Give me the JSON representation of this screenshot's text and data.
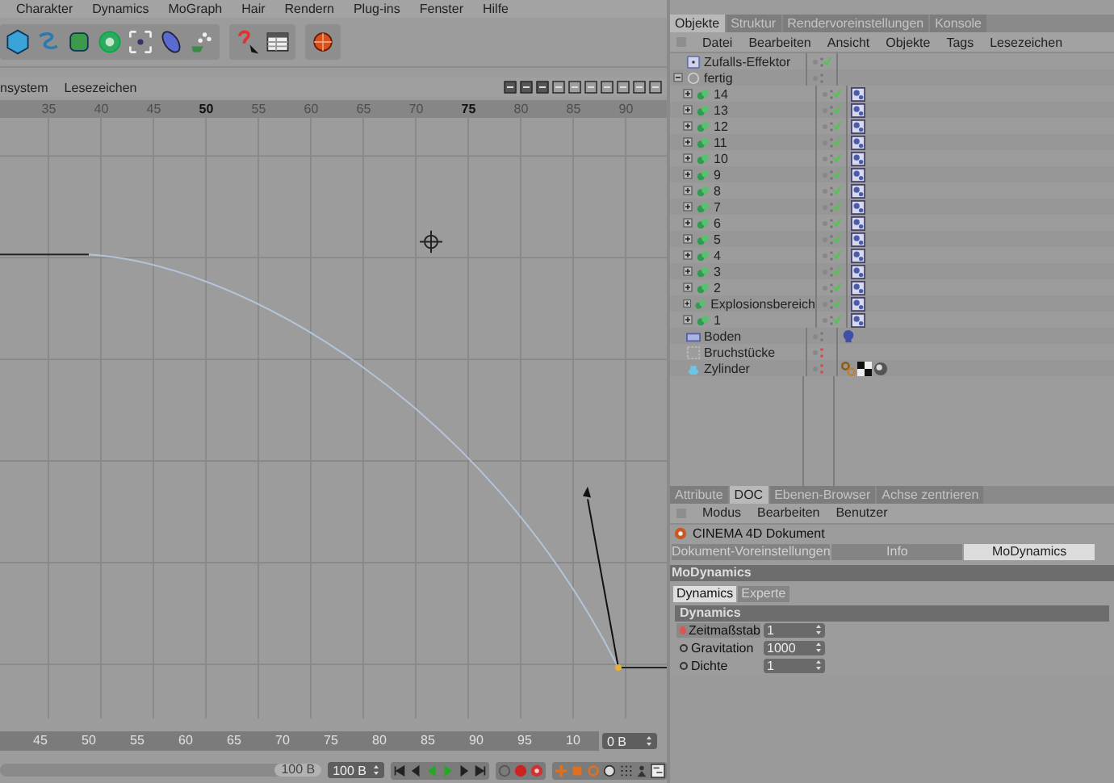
{
  "menu_bar": [
    "Charakter",
    "Dynamics",
    "MoGraph",
    "Hair",
    "Rendern",
    "Plug-ins",
    "Fenster",
    "Hilfe"
  ],
  "timeline_editor": {
    "menu": [
      "nsystem",
      "Lesezeichen"
    ],
    "ruler": [
      {
        "label": "35",
        "major": false
      },
      {
        "label": "40",
        "major": false
      },
      {
        "label": "45",
        "major": false
      },
      {
        "label": "50",
        "major": true
      },
      {
        "label": "55",
        "major": false
      },
      {
        "label": "60",
        "major": false
      },
      {
        "label": "65",
        "major": false
      },
      {
        "label": "70",
        "major": false
      },
      {
        "label": "75",
        "major": true
      },
      {
        "label": "80",
        "major": false
      },
      {
        "label": "85",
        "major": false
      },
      {
        "label": "90",
        "major": false
      }
    ],
    "frame_ruler": [
      "45",
      "50",
      "55",
      "60",
      "65",
      "70",
      "75",
      "80",
      "85",
      "90",
      "95",
      "10"
    ],
    "current_frame": "0 B",
    "range_slider": {
      "label": "100 B",
      "level": 1
    },
    "end_frame": "100 B"
  },
  "object_manager": {
    "tabs": [
      {
        "label": "Objekte",
        "selected": true
      },
      {
        "label": "Struktur",
        "selected": false
      },
      {
        "label": "Rendervoreinstellungen",
        "selected": false
      },
      {
        "label": "Konsole",
        "selected": false
      }
    ],
    "menu": [
      "Datei",
      "Bearbeiten",
      "Ansicht",
      "Objekte",
      "Tags",
      "Lesezeichen"
    ],
    "objects": [
      {
        "name": "Zufalls-Effektor",
        "kind": "effector",
        "enabled": true,
        "checked": true
      },
      {
        "name": "fertig",
        "kind": "null",
        "enabled": true,
        "checked": false,
        "expanded": true,
        "children": [
          {
            "name": "14",
            "kind": "cloner",
            "enabled": true,
            "checked": true,
            "expanded": false,
            "tags": [
              {
                "kind": "tile"
              }
            ]
          },
          {
            "name": "13",
            "kind": "cloner",
            "enabled": true,
            "checked": true,
            "expanded": false,
            "tags": [
              {
                "kind": "tile"
              }
            ]
          },
          {
            "name": "12",
            "kind": "cloner",
            "enabled": true,
            "checked": true,
            "expanded": false,
            "tags": [
              {
                "kind": "tile"
              }
            ]
          },
          {
            "name": "11",
            "kind": "cloner",
            "enabled": true,
            "checked": true,
            "expanded": false,
            "tags": [
              {
                "kind": "tile"
              }
            ]
          },
          {
            "name": "10",
            "kind": "cloner",
            "enabled": true,
            "checked": true,
            "expanded": false,
            "tags": [
              {
                "kind": "tile"
              }
            ]
          },
          {
            "name": "9",
            "kind": "cloner",
            "enabled": true,
            "checked": true,
            "expanded": false,
            "tags": [
              {
                "kind": "tile"
              }
            ]
          },
          {
            "name": "8",
            "kind": "cloner",
            "enabled": true,
            "checked": true,
            "expanded": false,
            "tags": [
              {
                "kind": "tile"
              }
            ]
          },
          {
            "name": "7",
            "kind": "cloner",
            "enabled": true,
            "checked": true,
            "expanded": false,
            "tags": [
              {
                "kind": "tile"
              }
            ]
          },
          {
            "name": "6",
            "kind": "cloner",
            "enabled": true,
            "checked": true,
            "expanded": false,
            "tags": [
              {
                "kind": "tile"
              }
            ]
          },
          {
            "name": "5",
            "kind": "cloner",
            "enabled": true,
            "checked": true,
            "expanded": false,
            "tags": [
              {
                "kind": "tile"
              }
            ]
          },
          {
            "name": "4",
            "kind": "cloner",
            "enabled": true,
            "checked": true,
            "expanded": false,
            "tags": [
              {
                "kind": "tile"
              }
            ]
          },
          {
            "name": "3",
            "kind": "cloner",
            "enabled": true,
            "checked": true,
            "expanded": false,
            "tags": [
              {
                "kind": "tile"
              }
            ]
          },
          {
            "name": "2",
            "kind": "cloner",
            "enabled": true,
            "checked": true,
            "expanded": false,
            "tags": [
              {
                "kind": "tile"
              }
            ]
          },
          {
            "name": "Explosionsbereich",
            "kind": "cloner",
            "enabled": true,
            "checked": true,
            "expanded": false,
            "tags": [
              {
                "kind": "tile"
              }
            ]
          },
          {
            "name": "1",
            "kind": "cloner",
            "enabled": true,
            "checked": true,
            "expanded": false,
            "tags": [
              {
                "kind": "tile"
              }
            ]
          }
        ]
      },
      {
        "name": "Boden",
        "kind": "floor",
        "enabled": true,
        "checked": false,
        "tags": [
          {
            "kind": "blob"
          }
        ]
      },
      {
        "name": "Bruchstücke",
        "kind": "fracture",
        "enabled": false,
        "checked": false
      },
      {
        "name": "Zylinder",
        "kind": "cylinder",
        "enabled": false,
        "checked": false,
        "tags": [
          {
            "kind": "chain"
          },
          {
            "kind": "checker"
          },
          {
            "kind": "sphere"
          }
        ]
      }
    ]
  },
  "attribute_manager": {
    "tabs": [
      {
        "label": "Attribute",
        "selected": false
      },
      {
        "label": "DOC",
        "selected": true
      },
      {
        "label": "Ebenen-Browser",
        "selected": false
      },
      {
        "label": "Achse zentrieren",
        "selected": false
      }
    ],
    "menu": [
      "Modus",
      "Bearbeiten",
      "Benutzer"
    ],
    "title": "CINEMA 4D Dokument",
    "section_tabs": [
      {
        "label": "Dokument-Voreinstellungen",
        "selected": false
      },
      {
        "label": "Info",
        "selected": false
      },
      {
        "label": "MoDynamics",
        "selected": true
      }
    ],
    "section_title": "MoDynamics",
    "sub_tabs": [
      {
        "label": "Dynamics",
        "selected": true
      },
      {
        "label": "Experte",
        "selected": false
      }
    ],
    "group_title": "Dynamics",
    "fields": [
      {
        "label": "Zeitmaßstab",
        "value": "1",
        "selected": true
      },
      {
        "label": "Gravitation",
        "value": "1000",
        "selected": false
      },
      {
        "label": "Dichte",
        "value": "1",
        "selected": false
      }
    ]
  }
}
